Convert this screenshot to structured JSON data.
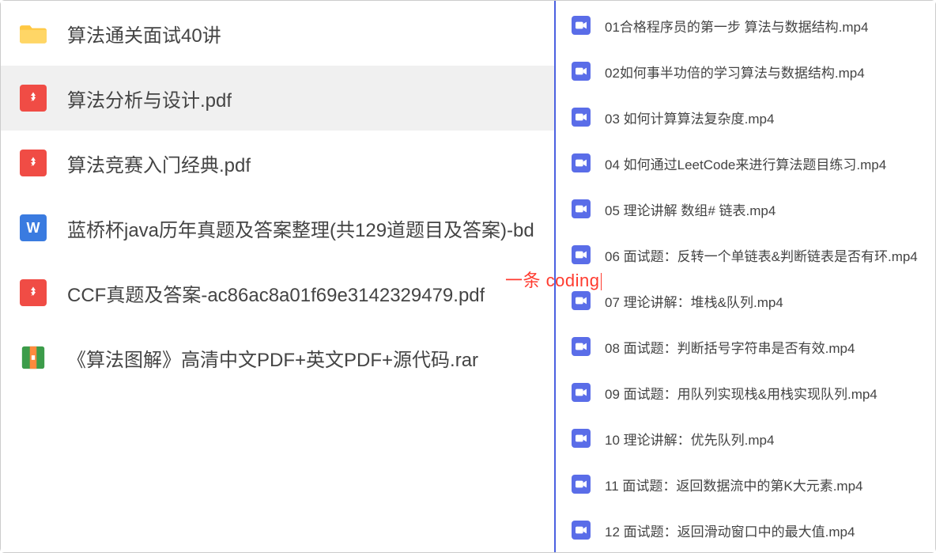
{
  "left_items": [
    {
      "type": "folder",
      "label": "算法通关面试40讲",
      "selected": false
    },
    {
      "type": "pdf",
      "label": "算法分析与设计.pdf",
      "selected": true
    },
    {
      "type": "pdf",
      "label": "算法竞赛入门经典.pdf",
      "selected": false
    },
    {
      "type": "word",
      "label": "蓝桥杯java历年真题及答案整理(共129道题目及答案)-bd",
      "selected": false
    },
    {
      "type": "pdf",
      "label": "CCF真题及答案-ac86ac8a01f69e3142329479.pdf",
      "selected": false
    },
    {
      "type": "rar",
      "label": "《算法图解》高清中文PDF+英文PDF+源代码.rar",
      "selected": false
    }
  ],
  "right_items": [
    {
      "type": "video",
      "label": "01合格程序员的第一步 算法与数据结构.mp4"
    },
    {
      "type": "video",
      "label": "02如何事半功倍的学习算法与数据结构.mp4"
    },
    {
      "type": "video",
      "label": "03 如何计算算法复杂度.mp4"
    },
    {
      "type": "video",
      "label": "04 如何通过LeetCode来进行算法题目练习.mp4"
    },
    {
      "type": "video",
      "label": "05 理论讲解 数组# 链表.mp4"
    },
    {
      "type": "video",
      "label": "06 面试题：反转一个单链表&判断链表是否有环.mp4"
    },
    {
      "type": "video",
      "label": "07 理论讲解：堆栈&队列.mp4"
    },
    {
      "type": "video",
      "label": "08 面试题：判断括号字符串是否有效.mp4"
    },
    {
      "type": "video",
      "label": "09 面试题：用队列实现栈&用栈实现队列.mp4"
    },
    {
      "type": "video",
      "label": "10 理论讲解：优先队列.mp4"
    },
    {
      "type": "video",
      "label": "11 面试题：返回数据流中的第K大元素.mp4"
    },
    {
      "type": "video",
      "label": "12 面试题：返回滑动窗口中的最大值.mp4"
    }
  ],
  "watermark": "一条 coding",
  "footer_mark": ""
}
